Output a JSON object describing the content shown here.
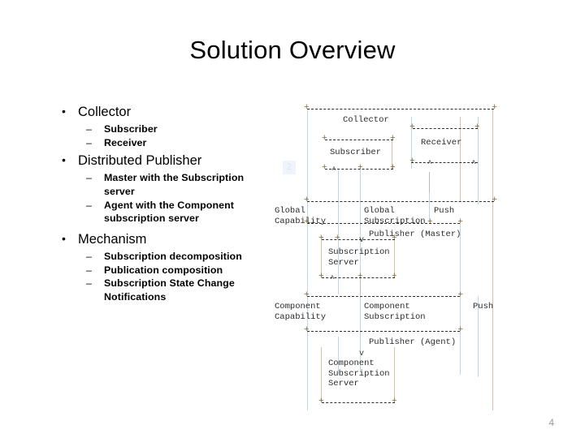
{
  "slide": {
    "title": "Solution Overview",
    "page_number": "4"
  },
  "bullets": [
    {
      "label": "Collector",
      "marker": "•",
      "children": [
        {
          "marker": "–",
          "label": "Subscriber"
        },
        {
          "marker": "–",
          "label": "Receiver"
        }
      ]
    },
    {
      "label": "Distributed Publisher",
      "marker": "•",
      "children": [
        {
          "marker": "–",
          "label": "Master with the Subscription server"
        },
        {
          "marker": "–",
          "label": "Agent with the Component subscription server"
        }
      ]
    },
    {
      "label": "Mechanism",
      "marker": "•",
      "children": [
        {
          "marker": "–",
          "label": "Subscription decomposition"
        },
        {
          "marker": "–",
          "label": "Publication composition"
        },
        {
          "marker": "–",
          "label": "Subscription State Change Notifications"
        }
      ]
    }
  ],
  "diagram": {
    "watermark": "2",
    "labels": {
      "collector": "Collector",
      "subscriber": "Subscriber",
      "receiver": "Receiver",
      "global_capability": "Global\nCapability",
      "global_subscription": "Global\nSubscription",
      "push_top": "Push",
      "publisher_master": "Publisher (Master)",
      "subscription_server": "Subscription\nServer",
      "component_capability": "Component\nCapability",
      "component_subscription": "Component\nSubscription",
      "push_bottom": "Push",
      "publisher_agent": "Publisher (Agent)",
      "component_subscription_server": "Component\nSubscription\nServer"
    },
    "colors": {
      "lifeline_blue": "#bcd9e8",
      "lifeline_tan": "#d8c2a4",
      "lifeline_grey": "#b9b9b9",
      "dash_border": "#2f2f2f",
      "text": "#2b2b2b"
    }
  }
}
